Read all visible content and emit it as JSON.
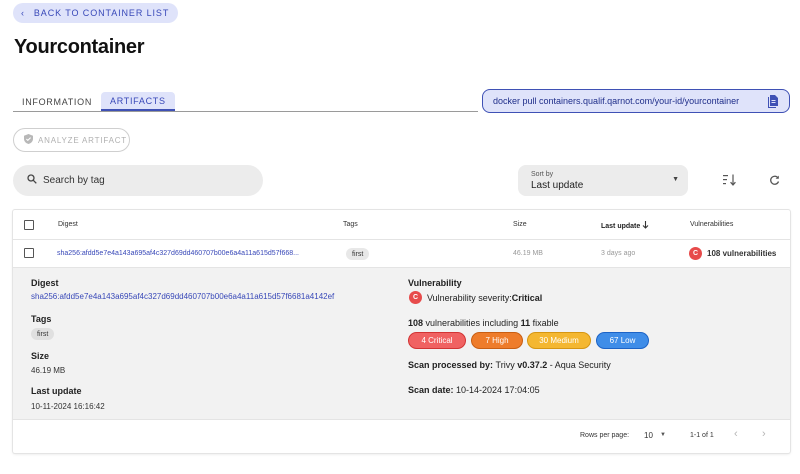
{
  "nav": {
    "back_label": "BACK TO CONTAINER LIST"
  },
  "page": {
    "title": "Yourcontainer"
  },
  "tabs": [
    {
      "label": "INFORMATION",
      "active": false
    },
    {
      "label": "ARTIFACTS",
      "active": true
    }
  ],
  "pull_command": "docker pull containers.qualif.qarnot.com/your-id/yourcontainer",
  "actions": {
    "analyze_label": "ANALYZE ARTIFACT"
  },
  "search": {
    "placeholder": "Search by tag"
  },
  "sort": {
    "label": "Sort by",
    "value": "Last update"
  },
  "table": {
    "headers": {
      "digest": "Digest",
      "tags": "Tags",
      "size": "Size",
      "last_update": "Last update",
      "vulnerabilities": "Vulnerabilities"
    },
    "rows": [
      {
        "digest": "sha256:afdd5e7e4a143a695af4c327d69dd460707b00e6a4a11a615d57f668...",
        "tag": "first",
        "size": "46.19 MB",
        "last_update": "3 days ago",
        "severity_letter": "C",
        "vulnerabilities": "108 vulnerabilities"
      }
    ]
  },
  "detail": {
    "digest_label": "Digest",
    "digest": "sha256:afdd5e7e4a143a695af4c327d69dd460707b00e6a4a11a615d57f6681a4142ef",
    "tags_label": "Tags",
    "tag": "first",
    "size_label": "Size",
    "size": "46.19 MB",
    "last_update_label": "Last update",
    "last_update": "10-11-2024 16:16:42",
    "vuln_label": "Vulnerability",
    "severity_letter": "C",
    "severity_prefix": "Vulnerability severity: ",
    "severity_value": "Critical",
    "count_total": "108",
    "count_mid": " vulnerabilities including ",
    "count_fixable": "11",
    "count_suffix": " fixable",
    "pills": {
      "critical": "4 Critical",
      "high": "7 High",
      "medium": "30 Medium",
      "low": "67 Low"
    },
    "scan_prefix": "Scan processed by: ",
    "scan_tool": "Trivy ",
    "scan_version": "v0.37.2",
    "scan_vendor": " - Aqua Security",
    "scan_date_label": "Scan date: ",
    "scan_date": "10-14-2024 17:04:05"
  },
  "pagination": {
    "rows_label": "Rows per page:",
    "rows_value": "10",
    "range": "1-1 of 1"
  },
  "colors": {
    "accent": "#3f51b5",
    "accent_bg": "#dfe3fa",
    "critical": "#e74b4b",
    "high": "#ee7c2b",
    "medium": "#f4b731",
    "low": "#3f8de8"
  }
}
